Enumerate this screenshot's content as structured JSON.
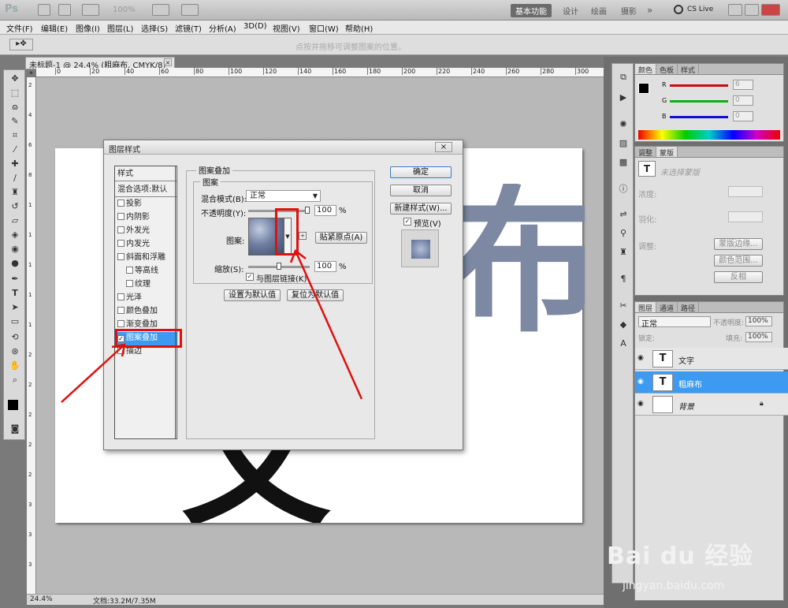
{
  "app": {
    "logo": "Ps",
    "zoom": "100%",
    "workspaces": [
      "基本功能",
      "设计",
      "绘画",
      "摄影"
    ],
    "more": "»",
    "cslive": "CS Live"
  },
  "menus": [
    "文件(F)",
    "编辑(E)",
    "图像(I)",
    "图层(L)",
    "选择(S)",
    "滤镜(T)",
    "分析(A)",
    "3D(D)",
    "视图(V)",
    "窗口(W)",
    "帮助(H)"
  ],
  "options_hint": "点按并拖移可调整图案的位置。",
  "document": {
    "tab_title": "未标题-1 @ 24.4% (粗麻布, CMYK/8) *",
    "zoom": "24.4%",
    "doc_info": "文档:33.2M/7.35M",
    "canvas_text_black": "文字",
    "canvas_text_pattern": "布"
  },
  "ruler_h": [
    "0",
    "20",
    "40",
    "60",
    "80",
    "100",
    "120",
    "140",
    "160",
    "180",
    "200",
    "220",
    "240",
    "260",
    "280",
    "300"
  ],
  "ruler_v": [
    "2",
    "4",
    "6",
    "8",
    "1",
    "1",
    "1",
    "1",
    "1",
    "2",
    "2",
    "2",
    "2",
    "2",
    "3",
    "3",
    "3"
  ],
  "dialog": {
    "title": "图层样式",
    "close": "×",
    "style_header": "样式",
    "blend_options": "混合选项:默认",
    "effects": [
      {
        "label": "投影",
        "checked": false,
        "indent": false
      },
      {
        "label": "内阴影",
        "checked": false,
        "indent": false
      },
      {
        "label": "外发光",
        "checked": false,
        "indent": false
      },
      {
        "label": "内发光",
        "checked": false,
        "indent": false
      },
      {
        "label": "斜面和浮雕",
        "checked": false,
        "indent": false
      },
      {
        "label": "等高线",
        "checked": false,
        "indent": true
      },
      {
        "label": "纹理",
        "checked": false,
        "indent": true
      },
      {
        "label": "光泽",
        "checked": false,
        "indent": false
      },
      {
        "label": "颜色叠加",
        "checked": false,
        "indent": false
      },
      {
        "label": "渐变叠加",
        "checked": false,
        "indent": false
      },
      {
        "label": "图案叠加",
        "checked": true,
        "indent": false,
        "selected": true
      },
      {
        "label": "描边",
        "checked": false,
        "indent": false
      }
    ],
    "section_title": "图案叠加",
    "group_title": "图案",
    "blend_mode_label": "混合模式(B):",
    "blend_mode_value": "正常",
    "opacity_label": "不透明度(Y):",
    "opacity_value": "100",
    "opacity_unit": "%",
    "opacity_level": 1.0,
    "pattern_label": "图案:",
    "snap_origin": "贴紧原点(A)",
    "scale_label": "缩放(S):",
    "scale_value": "100",
    "scale_unit": "%",
    "scale_level": 0.5,
    "link_label": "与图层链接(K)",
    "link_checked": true,
    "set_default": "设置为默认值",
    "reset_default": "复位为默认值",
    "ok": "确定",
    "cancel": "取消",
    "new_style": "新建样式(W)...",
    "preview_label": "预览(V)",
    "preview_checked": true
  },
  "color_panel": {
    "tabs": [
      "颜色",
      "色板",
      "样式"
    ],
    "channels": [
      {
        "name": "R",
        "value": "6",
        "color": "#e01010"
      },
      {
        "name": "G",
        "value": "0",
        "color": "#10b010"
      },
      {
        "name": "B",
        "value": "0",
        "color": "#1010d0"
      }
    ]
  },
  "adjust_panel": {
    "tabs": [
      "调整",
      "蒙版"
    ],
    "no_mask": "未选择蒙版",
    "density": "浓度:",
    "feather": "羽化:",
    "refine": "调整:",
    "mask_edge": "蒙版边缘...",
    "color_range": "颜色范围...",
    "invert": "反相"
  },
  "layers_panel": {
    "tabs": [
      "图层",
      "通道",
      "路径"
    ],
    "blend_mode": "正常",
    "opacity_label": "不透明度:",
    "opacity_value": "100%",
    "lock_label": "锁定:",
    "fill_label": "填充:",
    "fill_value": "100%",
    "layers": [
      {
        "name": "文字",
        "thumb": "T",
        "selected": false
      },
      {
        "name": "粗麻布",
        "thumb": "T",
        "selected": true
      },
      {
        "name": "背景",
        "thumb": "",
        "selected": false,
        "locked": true
      }
    ]
  },
  "watermark": {
    "logo": "Bai du 经验",
    "url": "jingyan.baidu.com"
  },
  "colors": {
    "selection": "#3c9bf0",
    "annotation": "#e01010",
    "accent_red": "#e01010"
  }
}
